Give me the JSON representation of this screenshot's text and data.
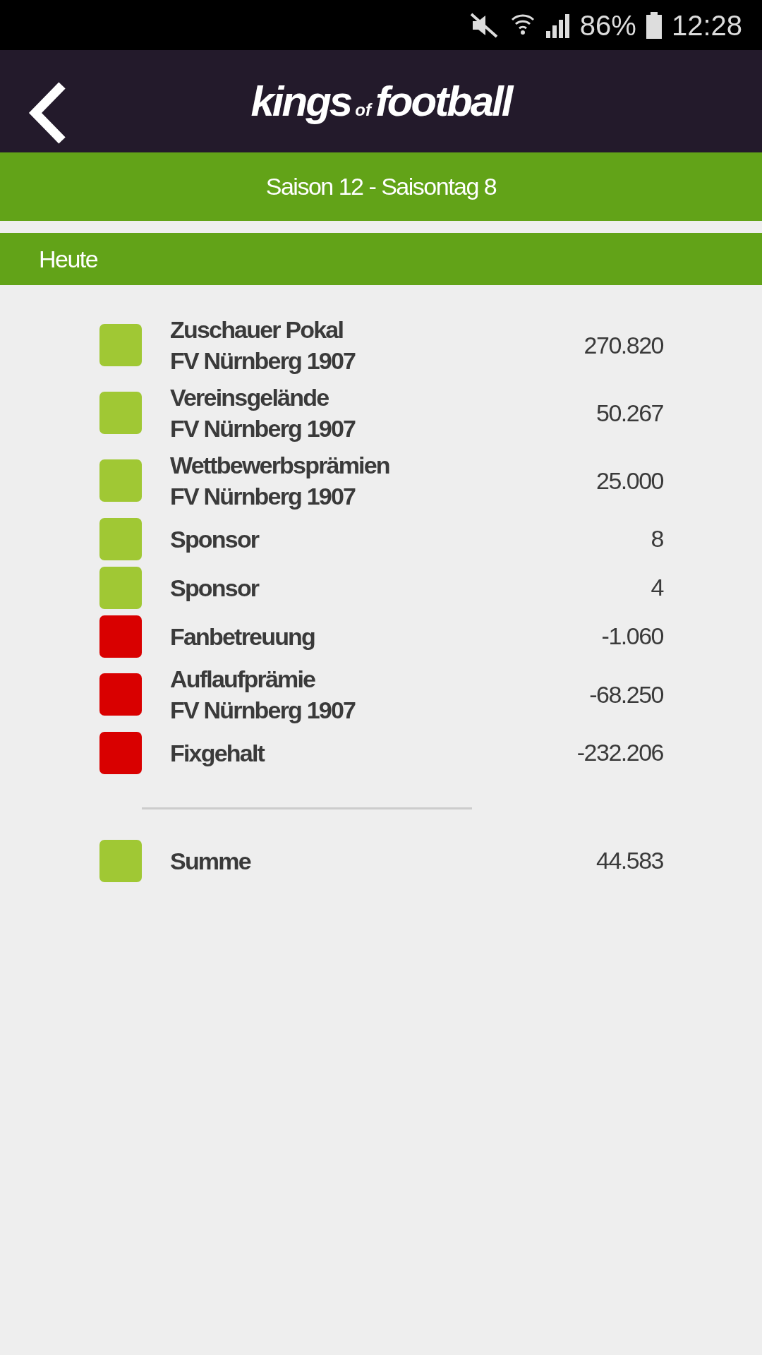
{
  "status_bar": {
    "battery_text": "86%",
    "time": "12:28"
  },
  "header": {
    "logo": [
      "kings",
      "of",
      "football"
    ]
  },
  "season_bar": {
    "title": "Saison 12 - Saisontag 8"
  },
  "section": {
    "title": "Heute"
  },
  "entries": [
    {
      "title": "Zuschauer Pokal",
      "subtitle": "FV Nürnberg 1907",
      "value": "270.820",
      "color": "#a0c834"
    },
    {
      "title": "Vereinsgelände",
      "subtitle": "FV Nürnberg 1907",
      "value": "50.267",
      "color": "#a0c834"
    },
    {
      "title": "Wettbewerbsprämien",
      "subtitle": "FV Nürnberg 1907",
      "value": "25.000",
      "color": "#a0c834"
    },
    {
      "title": "Sponsor",
      "value": "8",
      "color": "#a0c834"
    },
    {
      "title": "Sponsor",
      "value": "4",
      "color": "#a0c834"
    },
    {
      "title": "Fanbetreuung",
      "value": "-1.060",
      "color": "#d90000"
    },
    {
      "title": "Auflaufprämie",
      "subtitle": "FV Nürnberg 1907",
      "value": "-68.250",
      "color": "#d90000"
    },
    {
      "title": "Fixgehalt",
      "value": "-232.206",
      "color": "#d90000"
    }
  ],
  "total": {
    "title": "Summe",
    "value": "44.583",
    "color": "#a0c834"
  }
}
